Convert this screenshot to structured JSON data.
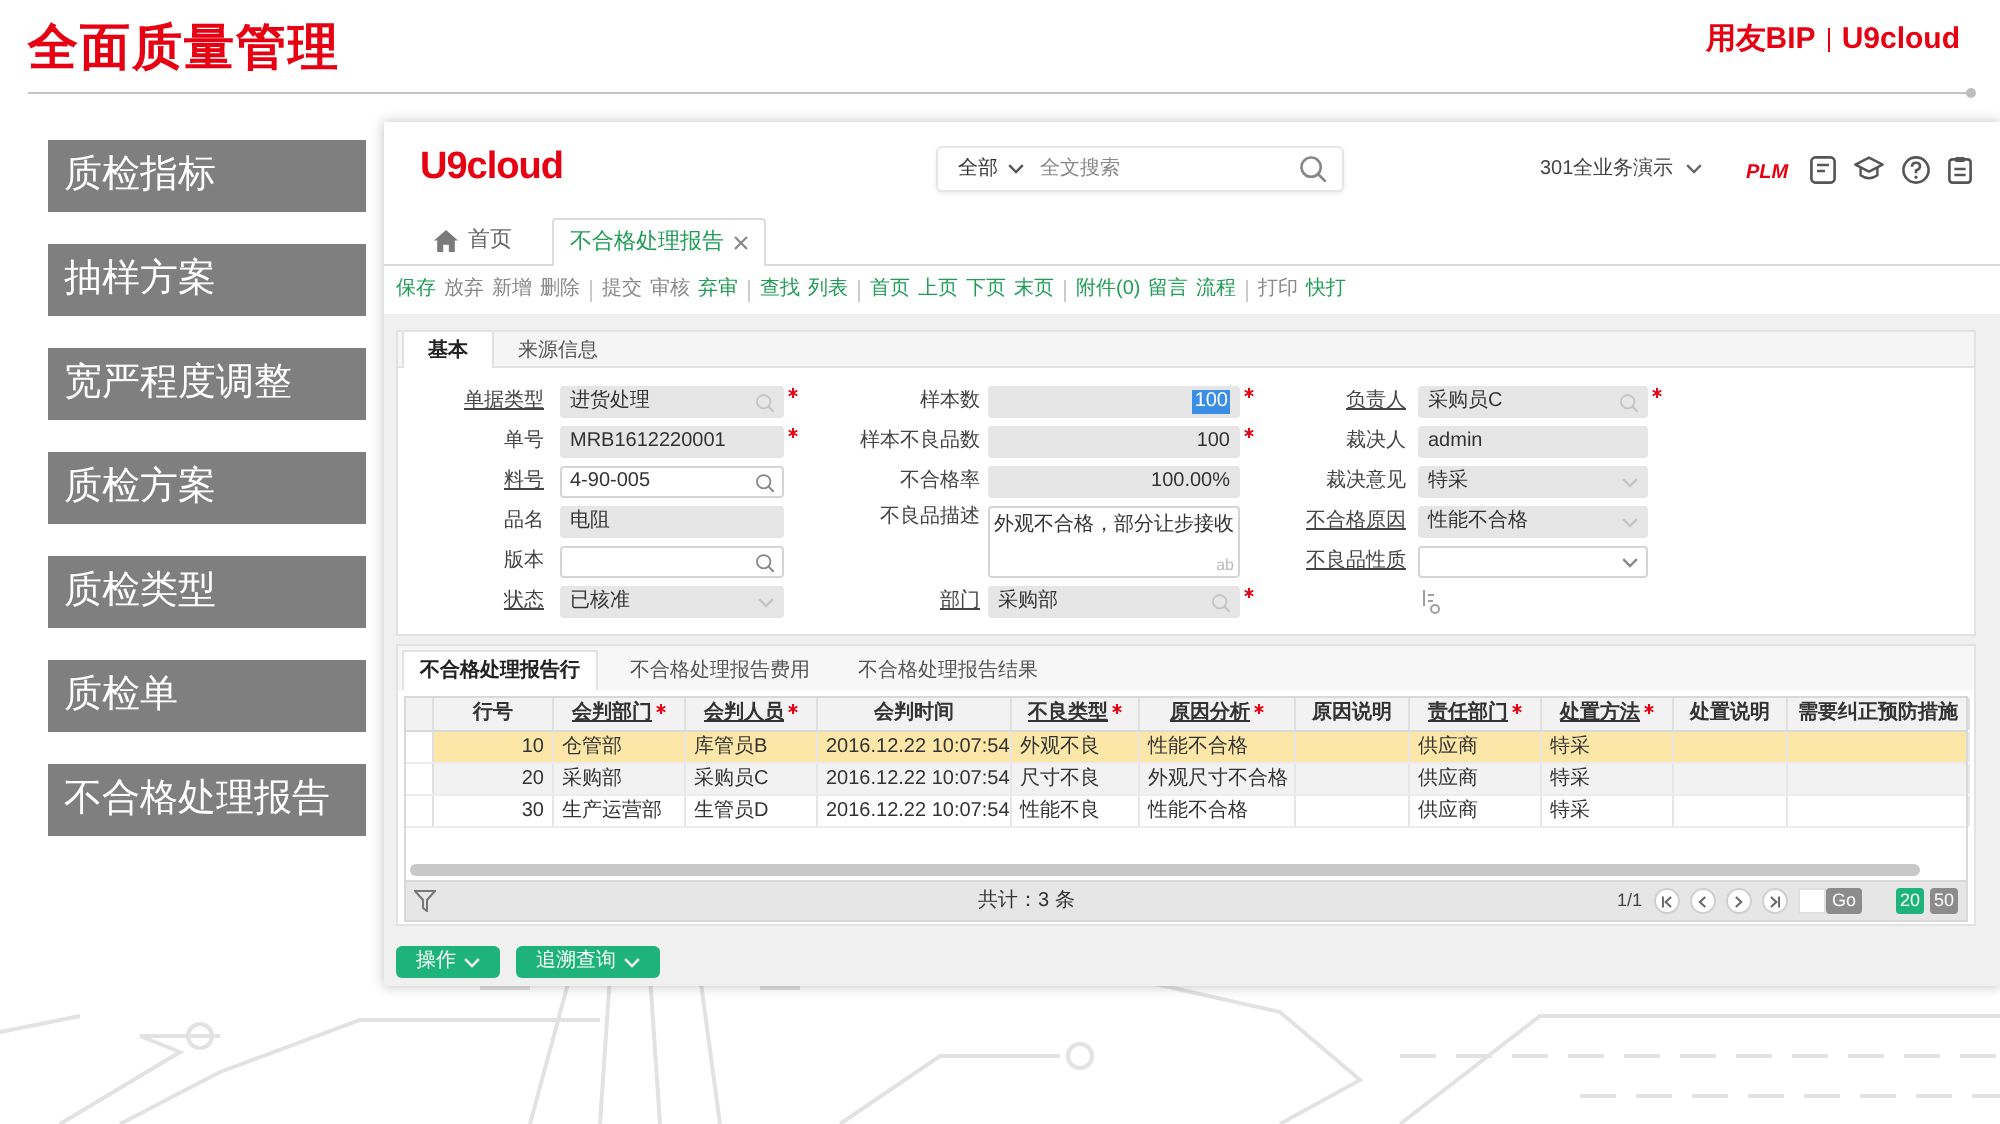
{
  "slide": {
    "title": "全面质量管理",
    "logo": [
      "用友BIP",
      "U9cloud"
    ]
  },
  "sidebar": {
    "items": [
      "质检指标",
      "抽样方案",
      "宽严程度调整",
      "质检方案",
      "质检类型",
      "质检单",
      "不合格处理报告"
    ]
  },
  "app": {
    "logo": "U9cloud",
    "search": {
      "scope": "全部",
      "placeholder": "全文搜索"
    },
    "account": "301全业务演示",
    "plm": "PLM",
    "tabs": [
      {
        "label": "首页",
        "kind": "home",
        "selected": false,
        "closable": false
      },
      {
        "label": "不合格处理报告",
        "kind": "page",
        "selected": true,
        "closable": true
      }
    ],
    "toolbar": [
      [
        {
          "label": "保存",
          "enabled": true
        },
        {
          "label": "放弃",
          "enabled": false
        },
        {
          "label": "新增",
          "enabled": false
        },
        {
          "label": "删除",
          "enabled": false
        }
      ],
      [
        {
          "label": "提交",
          "enabled": false
        },
        {
          "label": "审核",
          "enabled": false
        },
        {
          "label": "弃审",
          "enabled": true
        }
      ],
      [
        {
          "label": "查找",
          "enabled": true
        },
        {
          "label": "列表",
          "enabled": true
        }
      ],
      [
        {
          "label": "首页",
          "enabled": true
        },
        {
          "label": "上页",
          "enabled": true
        },
        {
          "label": "下页",
          "enabled": true
        },
        {
          "label": "末页",
          "enabled": true
        }
      ],
      [
        {
          "label": "附件(0)",
          "enabled": true
        },
        {
          "label": "留言",
          "enabled": true
        },
        {
          "label": "流程",
          "enabled": true
        }
      ],
      [
        {
          "label": "打印",
          "enabled": false
        },
        {
          "label": "快打",
          "enabled": true
        }
      ]
    ],
    "form": {
      "tabs": [
        {
          "label": "基本",
          "selected": true
        },
        {
          "label": "来源信息",
          "selected": false
        }
      ],
      "columns": [
        [
          {
            "label": "单据类型",
            "link": true,
            "value": "进货处理",
            "kind": "lookup",
            "editable": false,
            "required": true,
            "focused": false
          },
          {
            "label": "单号",
            "link": false,
            "value": "MRB1612220001",
            "kind": "text",
            "editable": false,
            "required": true,
            "focused": false
          },
          {
            "label": "料号",
            "link": true,
            "value": "4-90-005",
            "kind": "lookup",
            "editable": true,
            "required": false,
            "focused": false
          },
          {
            "label": "品名",
            "link": false,
            "value": "电阻",
            "kind": "text",
            "editable": false,
            "required": false,
            "focused": false
          },
          {
            "label": "版本",
            "link": false,
            "kind": "lookup",
            "editable": true,
            "required": false,
            "focused": false
          },
          {
            "label": "状态",
            "link": true,
            "value": "已核准",
            "kind": "select",
            "editable": false,
            "required": false,
            "focused": false
          }
        ],
        [
          {
            "label": "样本数",
            "link": false,
            "value": "100",
            "kind": "number",
            "editable": false,
            "required": true,
            "focused": true
          },
          {
            "label": "样本不良品数",
            "link": false,
            "value": "100",
            "kind": "number",
            "editable": false,
            "required": true,
            "focused": false
          },
          {
            "label": "不合格率",
            "link": false,
            "value": "100.00%",
            "kind": "number",
            "editable": false,
            "required": false,
            "focused": false
          },
          {
            "label": "不良品描述",
            "link": false,
            "value": "外观不合格，部分让步接收",
            "corner_text": "ab",
            "kind": "textarea",
            "editable": true,
            "required": false,
            "focused": false
          },
          {
            "label": "部门",
            "link": true,
            "value": "采购部",
            "kind": "lookup",
            "editable": false,
            "required": true,
            "focused": false
          }
        ],
        [
          {
            "label": "负责人",
            "link": true,
            "value": "采购员C",
            "kind": "lookup",
            "editable": false,
            "required": true,
            "focused": false
          },
          {
            "label": "裁决人",
            "link": false,
            "value": "admin",
            "kind": "text",
            "editable": false,
            "required": false,
            "focused": false
          },
          {
            "label": "裁决意见",
            "link": false,
            "value": "特采",
            "kind": "select",
            "editable": false,
            "required": false,
            "focused": false
          },
          {
            "label": "不合格原因",
            "link": true,
            "value": "性能不合格",
            "kind": "select",
            "editable": false,
            "required": false,
            "focused": false
          },
          {
            "label": "不良品性质",
            "link": true,
            "kind": "select",
            "editable": true,
            "required": false,
            "focused": false
          }
        ]
      ]
    },
    "detail": {
      "tabs": [
        {
          "label": "不合格处理报告行",
          "selected": true
        },
        {
          "label": "不合格处理报告费用",
          "selected": false
        },
        {
          "label": "不合格处理报告结果",
          "selected": false
        }
      ],
      "table": {
        "columns": [
          {
            "label": "行号",
            "required": false
          },
          {
            "label": "会判部门",
            "required": true
          },
          {
            "label": "会判人员",
            "required": true
          },
          {
            "label": "会判时间",
            "required": false
          },
          {
            "label": "不良类型",
            "required": true
          },
          {
            "label": "原因分析",
            "required": true
          },
          {
            "label": "原因说明",
            "required": false
          },
          {
            "label": "责任部门",
            "required": true
          },
          {
            "label": "处置方法",
            "required": true
          },
          {
            "label": "处置说明",
            "required": false
          },
          {
            "label": "需要纠正预防措施",
            "required": false
          }
        ],
        "rows": [
          {
            "selected": true,
            "cells": [
              "10",
              "仓管部",
              "库管员B",
              "2016.12.22 10:07:54",
              "外观不良",
              "性能不合格",
              null,
              "供应商",
              "特采",
              null,
              null
            ]
          },
          {
            "selected": false,
            "cells": [
              "20",
              "采购部",
              "采购员C",
              "2016.12.22 10:07:54",
              "尺寸不良",
              "外观尺寸不合格",
              null,
              "供应商",
              "特采",
              null,
              null
            ]
          },
          {
            "selected": false,
            "cells": [
              "30",
              "生产运营部",
              "生管员D",
              "2016.12.22 10:07:54",
              "性能不良",
              "性能不合格",
              null,
              "供应商",
              "特采",
              null,
              null
            ]
          }
        ]
      },
      "footer": {
        "total": "共计：3 条",
        "page": "1/1",
        "go": "Go",
        "page_sizes": [
          {
            "label": "20",
            "selected": true
          },
          {
            "label": "50",
            "selected": false
          }
        ]
      }
    },
    "actions": [
      {
        "label": "操作"
      },
      {
        "label": "追溯查询"
      }
    ]
  }
}
